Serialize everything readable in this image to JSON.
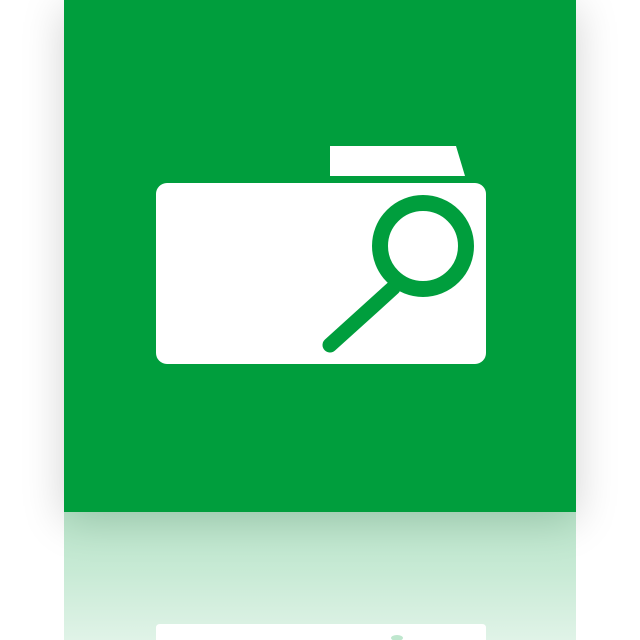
{
  "app_icon": {
    "semantic": "folder-search",
    "tile_color": "#009e3d",
    "glyph_color": "#ffffff",
    "reflection": true
  }
}
